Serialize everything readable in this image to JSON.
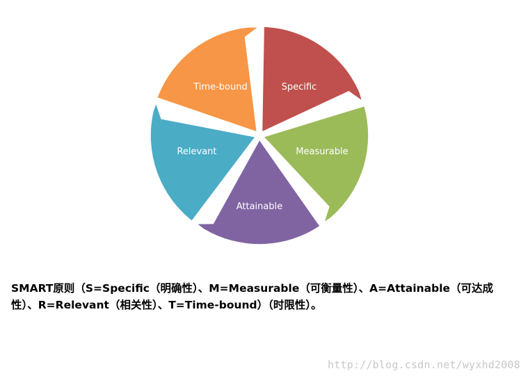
{
  "diagram": {
    "segments": [
      {
        "label": "Specific",
        "color": "#C0504D"
      },
      {
        "label": "Measurable",
        "color": "#9BBB59"
      },
      {
        "label": "Attainable",
        "color": "#8064A2"
      },
      {
        "label": "Relevant",
        "color": "#4BACC6"
      },
      {
        "label": "Time-bound",
        "color": "#F79646"
      }
    ]
  },
  "caption": {
    "text": "SMART原则（S=Specific（明确性）、M=Measurable（可衡量性）、A=Attainable（可达成性）、R=Relevant（相关性）、T=Time-bound）（时限性）。"
  },
  "watermark": {
    "text": "http://blog.csdn.net/wyxhd2008"
  }
}
